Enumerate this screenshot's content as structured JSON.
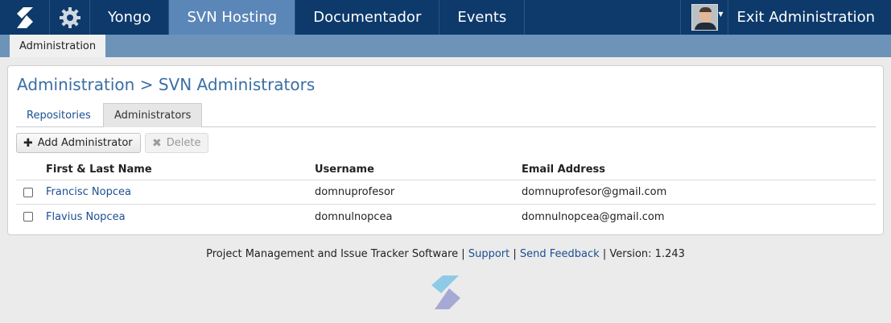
{
  "topnav": {
    "items": [
      {
        "label": "Yongo",
        "active": false
      },
      {
        "label": "SVN Hosting",
        "active": true
      },
      {
        "label": "Documentador",
        "active": false
      },
      {
        "label": "Events",
        "active": false
      }
    ],
    "exit_label": "Exit Administration",
    "logo_icon": "yongo-logo-icon",
    "settings_icon": "gear-icon",
    "colors": {
      "bar": "#0d3a6b",
      "active": "#5b86b8"
    }
  },
  "subnav": {
    "active_tab": "Administration"
  },
  "page": {
    "breadcrumb": "Administration > SVN Administrators",
    "tabs": [
      {
        "label": "Repositories",
        "active": false
      },
      {
        "label": "Administrators",
        "active": true
      }
    ],
    "toolbar": {
      "add_label": "Add Administrator",
      "delete_label": "Delete"
    },
    "table": {
      "columns": [
        "First & Last Name",
        "Username",
        "Email Address"
      ],
      "rows": [
        {
          "name": "Francisc Nopcea",
          "username": "domnuprofesor",
          "email": "domnuprofesor@gmail.com",
          "checked": false
        },
        {
          "name": "Flavius Nopcea",
          "username": "domnulnopcea",
          "email": "domnulnopcea@gmail.com",
          "checked": false
        }
      ]
    }
  },
  "footer": {
    "product": "Project Management and Issue Tracker Software",
    "support": "Support",
    "feedback": "Send Feedback",
    "version": "Version: 1.243",
    "separator": "|"
  }
}
